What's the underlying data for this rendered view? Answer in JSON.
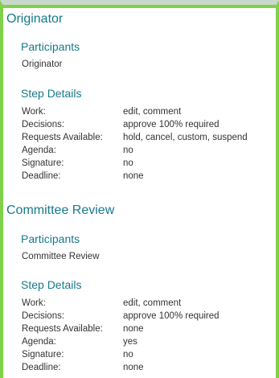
{
  "steps": [
    {
      "title": "Originator",
      "participants_heading": "Participants",
      "participant": "Originator",
      "details_heading": "Step Details",
      "details": [
        {
          "label": "Work:",
          "value": "edit, comment"
        },
        {
          "label": "Decisions:",
          "value": "approve 100% required"
        },
        {
          "label": "Requests Available:",
          "value": "hold, cancel, custom, suspend"
        },
        {
          "label": "Agenda:",
          "value": "no"
        },
        {
          "label": "Signature:",
          "value": "no"
        },
        {
          "label": "Deadline:",
          "value": "none"
        }
      ]
    },
    {
      "title": "Committee Review",
      "participants_heading": "Participants",
      "participant": "Committee Review",
      "details_heading": "Step Details",
      "details": [
        {
          "label": "Work:",
          "value": "edit, comment"
        },
        {
          "label": "Decisions:",
          "value": "approve 100% required"
        },
        {
          "label": "Requests Available:",
          "value": "none"
        },
        {
          "label": "Agenda:",
          "value": "yes"
        },
        {
          "label": "Signature:",
          "value": "no"
        },
        {
          "label": "Deadline:",
          "value": "none"
        }
      ]
    }
  ],
  "colors": {
    "heading": "#167a8c",
    "text": "#333333",
    "border": "#7fd14a"
  }
}
